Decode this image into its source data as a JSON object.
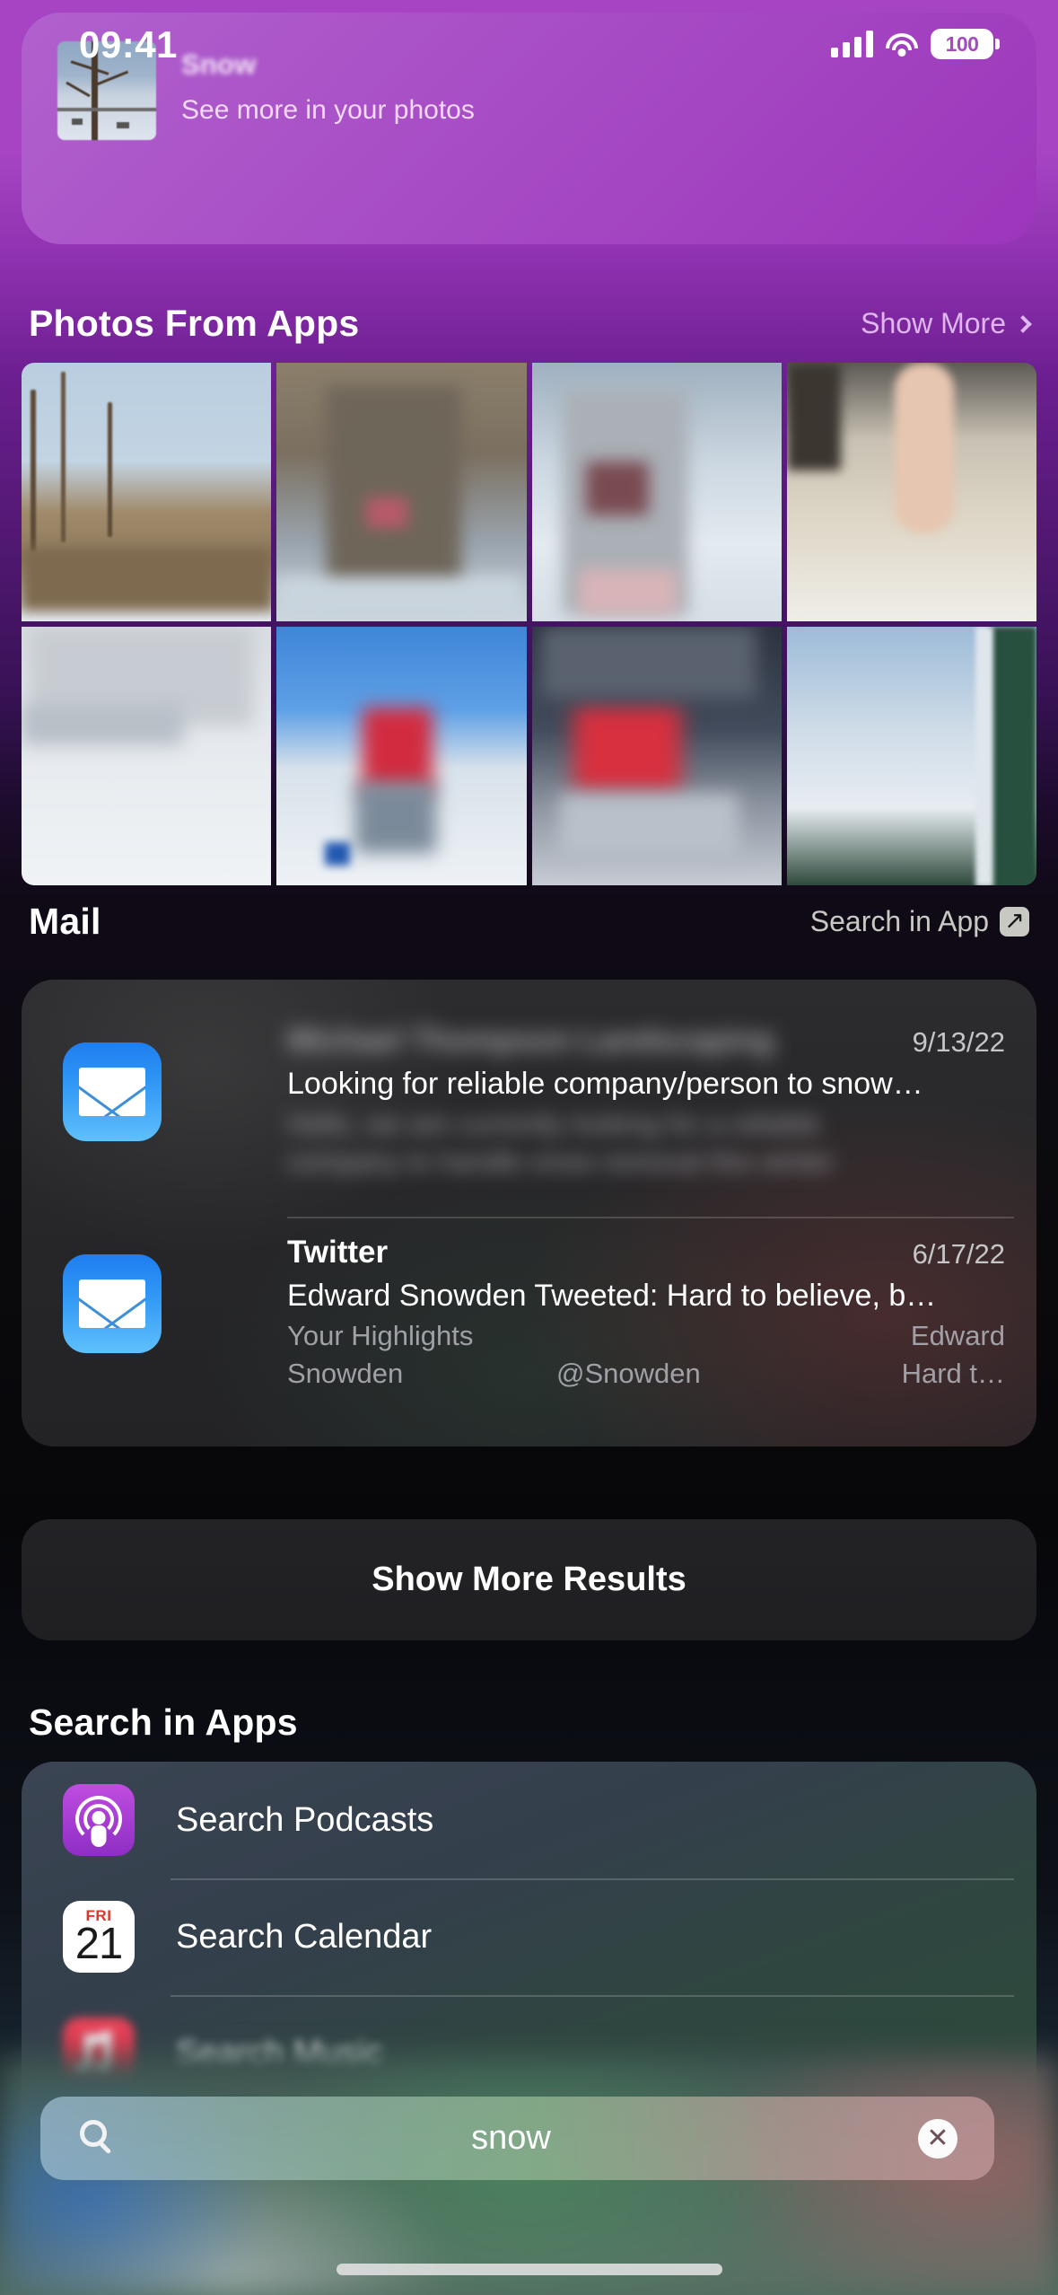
{
  "status_bar": {
    "time": "09:41",
    "battery": "100",
    "signal_icon": "cellular-bars-icon",
    "wifi_icon": "wifi-icon",
    "battery_icon": "battery-icon"
  },
  "top_card": {
    "title": "Snow",
    "subtitle": "See more in your photos",
    "thumbnail_name": "snow-trees-photo",
    "background_color": "#a94fc6"
  },
  "photos_section": {
    "title": "Photos From Apps",
    "show_more_label": "Show More",
    "chevron_icon": "chevron-right-icon",
    "photos": [
      {
        "name": "snowy-field-with-bare-trees",
        "censored": false
      },
      {
        "name": "roadside-guardrail-snow",
        "censored": true
      },
      {
        "name": "snowy-cemetery-path",
        "censored": true
      },
      {
        "name": "finger-touching-snow",
        "censored": false
      },
      {
        "name": "snow-covered-ground",
        "censored": true
      },
      {
        "name": "snow-field-blue-sky",
        "censored": true
      },
      {
        "name": "dark-snow-scene",
        "censored": true
      },
      {
        "name": "snow-against-green-door",
        "censored": false
      }
    ]
  },
  "mail_section": {
    "title": "Mail",
    "search_in_app_label": "Search in App",
    "search_in_app_icon": "arrow-up-right-box-icon",
    "app_icon_name": "mail-app-icon",
    "messages": [
      {
        "sender": "",
        "sender_redacted": true,
        "date": "9/13/22",
        "subject": "Looking for reliable company/person to snow…",
        "preview_line1": "",
        "preview_line2": "",
        "preview_redacted": true
      },
      {
        "sender": "Twitter",
        "sender_redacted": false,
        "date": "6/17/22",
        "subject": "Edward Snowden Tweeted: Hard to believe, b…",
        "preview_left1": "Your Highlights",
        "preview_right1": "Edward",
        "preview_left2": "Snowden",
        "preview_mid2": "@Snowden",
        "preview_right2": "Hard t…",
        "preview_redacted": false
      }
    ]
  },
  "show_more_results": {
    "label": "Show More Results"
  },
  "search_in_apps": {
    "title": "Search in Apps",
    "rows": [
      {
        "label": "Search Podcasts",
        "icon": "podcasts-app-icon"
      },
      {
        "label": "Search Calendar",
        "icon": "calendar-app-icon",
        "day_of_week": "FRI",
        "day": "21"
      },
      {
        "label": "Search Music",
        "icon": "music-app-icon"
      }
    ]
  },
  "search_field": {
    "value": "snow",
    "placeholder": "Search",
    "search_icon": "magnifier-icon",
    "clear_icon": "clear-x-icon",
    "clear_glyph": "✕"
  },
  "home_indicator": {
    "name": "home-indicator"
  }
}
